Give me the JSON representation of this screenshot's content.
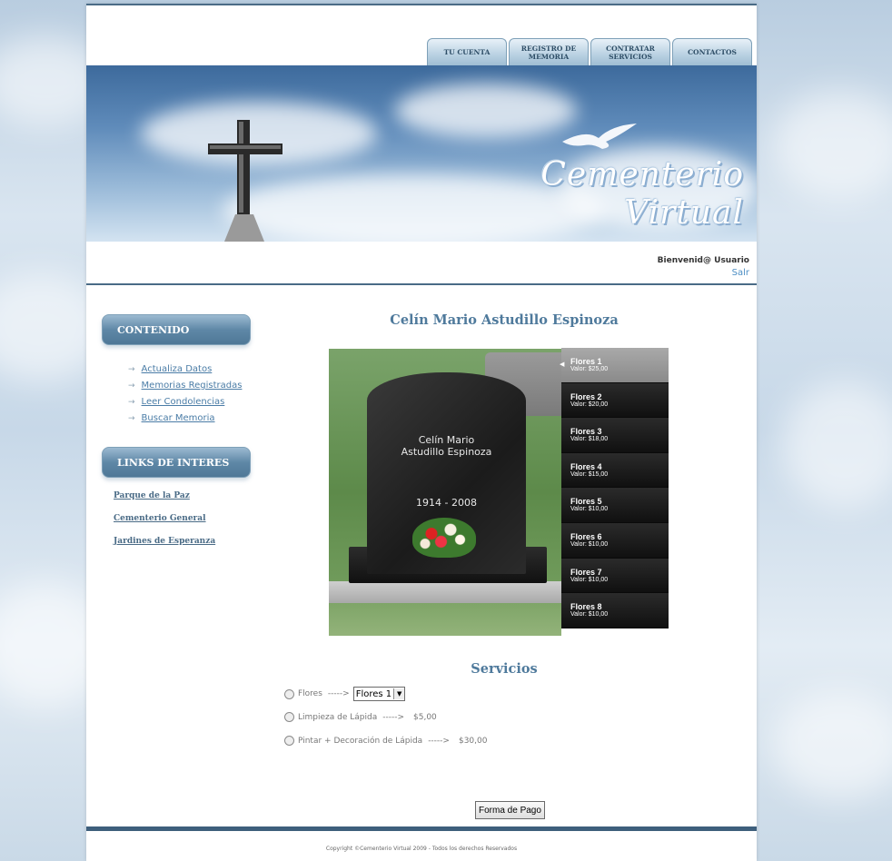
{
  "nav": {
    "tabs": [
      {
        "label": "TU CUENTA"
      },
      {
        "label": "REGISTRO DE MEMORIA"
      },
      {
        "label": "CONTRATAR SERVICIOS"
      },
      {
        "label": "CONTACTOS"
      }
    ]
  },
  "banner": {
    "logo_line1": "Cementerio",
    "logo_line2": "Virtual"
  },
  "user": {
    "welcome": "Bienvenid@ Usuario",
    "logout": "Salr"
  },
  "sidebar": {
    "contenido_header": "CONTENIDO",
    "contenido_items": [
      {
        "label": "Actualiza Datos"
      },
      {
        "label": "Memorias Registradas"
      },
      {
        "label": "Leer Condolencias"
      },
      {
        "label": "Buscar Memoria"
      }
    ],
    "links_header": "LINKS DE INTERES",
    "links": [
      {
        "label": "Parque de la Paz"
      },
      {
        "label": "Cementerio General"
      },
      {
        "label": "Jardines de Esperanza"
      }
    ]
  },
  "memorial": {
    "title": "Celín Mario Astudillo Espinoza",
    "stone_name_line1": "Celín Mario",
    "stone_name_line2": "Astudillo Espinoza",
    "stone_years": "1914 - 2008"
  },
  "flowers": [
    {
      "name": "Flores 1",
      "value": "Valor: $25,00"
    },
    {
      "name": "Flores 2",
      "value": "Valor: $20,00"
    },
    {
      "name": "Flores 3",
      "value": "Valor: $18,00"
    },
    {
      "name": "Flores 4",
      "value": "Valor: $15,00"
    },
    {
      "name": "Flores 5",
      "value": "Valor: $10,00"
    },
    {
      "name": "Flores 6",
      "value": "Valor: $10,00"
    },
    {
      "name": "Flores 7",
      "value": "Valor: $10,00"
    },
    {
      "name": "Flores 8",
      "value": "Valor: $10,00"
    }
  ],
  "services": {
    "title": "Servicios",
    "flores_label": "Flores",
    "flores_arrow": "----->",
    "flores_selected": "Flores 1",
    "limpieza_label": "Limpieza de Lápida",
    "limpieza_arrow": "----->",
    "limpieza_price": "$5,00",
    "pintar_label": "Pintar + Decoración de Lápida",
    "pintar_arrow": "----->",
    "pintar_price": "$30,00",
    "pay_button": "Forma de Pago"
  },
  "footer": {
    "copyright": "Copyright ©Cementerio Virtual 2009 - Todos los derechos Reservados"
  },
  "colors": {
    "accent": "#4a6b86",
    "title": "#4f7a9c",
    "link": "#4a7ca6"
  },
  "icons": {
    "menu_bullet": "arrow-right-icon",
    "select_toggle": "chevron-down-icon",
    "active_flower": "triangle-left-icon"
  }
}
